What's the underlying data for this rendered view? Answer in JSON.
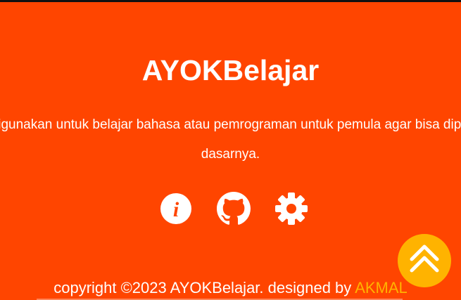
{
  "footer": {
    "brand": "AYOKBelajar",
    "description": "Website ini digunakan untuk belajar bahasa atau pemrograman untuk pemula agar bisa dipahami dasar-dasarnya.",
    "icons": {
      "info": "info-icon",
      "github": "github-icon",
      "settings": "gear-icon"
    },
    "copyright_text": "copyright ©2023 AYOKBelajar. designed by ",
    "author_name": "AKMAL",
    "scroll_top_icon": "double-chevron-up-icon"
  },
  "colors": {
    "background": "#ff4500",
    "text": "#ffffff",
    "accent": "#ffb300",
    "top_border": "#111111"
  }
}
